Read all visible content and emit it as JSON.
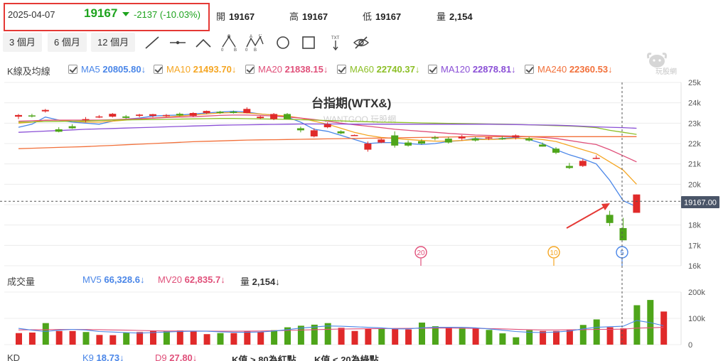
{
  "quote": {
    "date": "2025-04-07",
    "last": "19167",
    "change": "-2137 (-10.03%)",
    "stats": [
      {
        "label": "開",
        "value": "19167"
      },
      {
        "label": "高",
        "value": "19167"
      },
      {
        "label": "低",
        "value": "19167"
      },
      {
        "label": "量",
        "value": "2,154"
      }
    ]
  },
  "toolbar": {
    "periods": [
      "3 個月",
      "6 個月",
      "12 個月"
    ],
    "tools": [
      "line-tool-icon",
      "horizontal-line-icon",
      "angle-tool-icon",
      "ab-pattern-icon",
      "abc-pattern-icon",
      "circle-tool-icon",
      "rectangle-tool-icon",
      "text-tool-icon",
      "hide-eye-icon"
    ],
    "tool_text_label": "TXT",
    "pattern_letters": [
      "0",
      "A",
      "B",
      "0",
      "A",
      "B",
      "C"
    ]
  },
  "logo": {
    "text": "玩股網"
  },
  "kline_legend": {
    "title": "K線及均線",
    "mas": [
      {
        "label": "MA5",
        "value": "20805.80↓",
        "color": "#4a86e8"
      },
      {
        "label": "MA10",
        "value": "21493.70↓",
        "color": "#f5a623"
      },
      {
        "label": "MA20",
        "value": "21838.15↓",
        "color": "#e0507a"
      },
      {
        "label": "MA60",
        "value": "22740.37↓",
        "color": "#8cbf26"
      },
      {
        "label": "MA120",
        "value": "22878.81↓",
        "color": "#8a4fd6"
      },
      {
        "label": "MA240",
        "value": "22360.53↓",
        "color": "#f2703a"
      }
    ]
  },
  "volume_legend": {
    "title": "成交量",
    "items": [
      {
        "label": "MV5",
        "value": "66,328.6↓",
        "color": "#4a86e8"
      },
      {
        "label": "MV20",
        "value": "62,835.7↓",
        "color": "#e0507a"
      },
      {
        "label": "量",
        "value": "2,154↓",
        "color": "#333333"
      }
    ]
  },
  "kd_legend": {
    "title": "KD",
    "items": [
      {
        "label": "K9",
        "value": "18.73↓",
        "color": "#4a86e8"
      },
      {
        "label": "D9",
        "value": "27.80↓",
        "color": "#e0507a"
      },
      {
        "label": "K值 > 80為紅點",
        "value": "",
        "color": "#333333"
      },
      {
        "label": "K值 < 20為綠點",
        "value": "",
        "color": "#333333"
      }
    ]
  },
  "colors": {
    "up": "#e02a2a",
    "down": "#4ea51a",
    "crosshair": "#555555",
    "arrow": "#e53935"
  },
  "chart_data": {
    "type": "candlestick",
    "title": "台指期(WTX&)",
    "watermark": "WANTGOO 玩股網",
    "price_axis": {
      "ylim": [
        16000,
        25000
      ],
      "ticks": [
        16000,
        17000,
        18000,
        19000,
        20000,
        21000,
        22000,
        23000,
        24000,
        25000
      ],
      "tick_labels": [
        "16k",
        "17k",
        "18k",
        "19k",
        "20k",
        "21k",
        "22k",
        "23k",
        "24k",
        "25k"
      ]
    },
    "price_label": "19167.00",
    "crosshair_price": 19167,
    "candles": [
      {
        "o": 23320,
        "h": 23450,
        "l": 23200,
        "c": 23400
      },
      {
        "o": 23380,
        "h": 23460,
        "l": 23280,
        "c": 23340
      },
      {
        "o": 23580,
        "h": 23700,
        "l": 23520,
        "c": 23650
      },
      {
        "o": 22700,
        "h": 22800,
        "l": 22550,
        "c": 22580
      },
      {
        "o": 22850,
        "h": 22950,
        "l": 22720,
        "c": 22750
      },
      {
        "o": 23150,
        "h": 23300,
        "l": 23050,
        "c": 23200
      },
      {
        "o": 23320,
        "h": 23400,
        "l": 23250,
        "c": 23330
      },
      {
        "o": 23320,
        "h": 23500,
        "l": 23280,
        "c": 23460
      },
      {
        "o": 23330,
        "h": 23400,
        "l": 23220,
        "c": 23260
      },
      {
        "o": 23360,
        "h": 23460,
        "l": 23290,
        "c": 23420
      },
      {
        "o": 23360,
        "h": 23460,
        "l": 23280,
        "c": 23440
      },
      {
        "o": 23360,
        "h": 23450,
        "l": 23300,
        "c": 23400
      },
      {
        "o": 23460,
        "h": 23520,
        "l": 23340,
        "c": 23380
      },
      {
        "o": 23360,
        "h": 23540,
        "l": 23300,
        "c": 23500
      },
      {
        "o": 23500,
        "h": 23620,
        "l": 23450,
        "c": 23600
      },
      {
        "o": 23560,
        "h": 23600,
        "l": 23460,
        "c": 23500
      },
      {
        "o": 23560,
        "h": 23620,
        "l": 23470,
        "c": 23500
      },
      {
        "o": 23500,
        "h": 23780,
        "l": 23480,
        "c": 23700
      },
      {
        "o": 23250,
        "h": 23360,
        "l": 23200,
        "c": 23320
      },
      {
        "o": 23200,
        "h": 23500,
        "l": 23150,
        "c": 23450
      },
      {
        "o": 23450,
        "h": 23500,
        "l": 23250,
        "c": 23200
      },
      {
        "o": 22750,
        "h": 22830,
        "l": 22550,
        "c": 22650
      },
      {
        "o": 22350,
        "h": 22750,
        "l": 22300,
        "c": 22650
      },
      {
        "o": 22800,
        "h": 23050,
        "l": 22750,
        "c": 22950
      },
      {
        "o": 22600,
        "h": 22650,
        "l": 22460,
        "c": 22500
      },
      {
        "o": 22420,
        "h": 22440,
        "l": 22400,
        "c": 22420
      },
      {
        "o": 21700,
        "h": 22100,
        "l": 21600,
        "c": 22000
      },
      {
        "o": 22050,
        "h": 22240,
        "l": 22020,
        "c": 22200
      },
      {
        "o": 22400,
        "h": 22600,
        "l": 21800,
        "c": 21900
      },
      {
        "o": 22050,
        "h": 22150,
        "l": 21850,
        "c": 21900
      },
      {
        "o": 22120,
        "h": 22220,
        "l": 21950,
        "c": 22000
      },
      {
        "o": 22300,
        "h": 22380,
        "l": 22160,
        "c": 22250
      },
      {
        "o": 22240,
        "h": 22320,
        "l": 22000,
        "c": 22050
      },
      {
        "o": 22250,
        "h": 22420,
        "l": 22150,
        "c": 22350
      },
      {
        "o": 22250,
        "h": 22330,
        "l": 22100,
        "c": 22150
      },
      {
        "o": 22250,
        "h": 22340,
        "l": 22170,
        "c": 22300
      },
      {
        "o": 22260,
        "h": 22360,
        "l": 22180,
        "c": 22220
      },
      {
        "o": 22300,
        "h": 22450,
        "l": 22200,
        "c": 22400
      },
      {
        "o": 22250,
        "h": 22330,
        "l": 22100,
        "c": 22150
      },
      {
        "o": 21950,
        "h": 22050,
        "l": 21850,
        "c": 21850
      },
      {
        "o": 21750,
        "h": 21820,
        "l": 21480,
        "c": 21550
      },
      {
        "o": 20900,
        "h": 21050,
        "l": 20750,
        "c": 20800
      },
      {
        "o": 20900,
        "h": 21250,
        "l": 20850,
        "c": 21150
      },
      {
        "o": 21300,
        "h": 21420,
        "l": 21240,
        "c": 21300
      },
      {
        "o": 18500,
        "h": 18700,
        "l": 17950,
        "c": 18100
      },
      {
        "o": 17850,
        "h": 18350,
        "l": 17400,
        "c": 17250
      },
      {
        "o": 18600,
        "h": 19500,
        "l": 18600,
        "c": 19500
      }
    ],
    "ma_lines": [
      {
        "name": "MA5",
        "color": "#4a86e8",
        "values": [
          22800,
          22950,
          23300,
          23150,
          23050,
          23000,
          22950,
          23100,
          23200,
          23250,
          23350,
          23380,
          23400,
          23450,
          23500,
          23550,
          23580,
          23550,
          23450,
          23400,
          23300,
          23050,
          22700,
          22600,
          22400,
          22200,
          22000,
          22050,
          22050,
          22000,
          21950,
          22000,
          22100,
          22150,
          22250,
          22200,
          22250,
          22300,
          22200,
          22000,
          21700,
          21450,
          21250,
          21000,
          20200,
          19200,
          18900
        ]
      },
      {
        "name": "MA10",
        "color": "#f5a623",
        "values": [
          23000,
          23050,
          23150,
          23150,
          23100,
          23050,
          23050,
          23100,
          23150,
          23200,
          23250,
          23300,
          23350,
          23400,
          23450,
          23500,
          23520,
          23500,
          23450,
          23400,
          23350,
          23250,
          23100,
          22950,
          22750,
          22550,
          22400,
          22300,
          22250,
          22200,
          22150,
          22120,
          22120,
          22150,
          22200,
          22200,
          22220,
          22250,
          22250,
          22200,
          22100,
          21900,
          21700,
          21500,
          21100,
          20700,
          20000
        ]
      },
      {
        "name": "MA20",
        "color": "#e0507a",
        "values": [
          23100,
          23120,
          23140,
          23150,
          23150,
          23150,
          23150,
          23170,
          23200,
          23220,
          23250,
          23280,
          23300,
          23320,
          23350,
          23380,
          23400,
          23400,
          23380,
          23350,
          23300,
          23250,
          23180,
          23100,
          23000,
          22920,
          22850,
          22780,
          22700,
          22650,
          22600,
          22550,
          22500,
          22460,
          22420,
          22400,
          22380,
          22360,
          22340,
          22300,
          22250,
          22150,
          22050,
          21950,
          21700,
          21400,
          21100
        ]
      },
      {
        "name": "MA60",
        "color": "#8cbf26",
        "values": [
          23050,
          23060,
          23080,
          23090,
          23100,
          23110,
          23130,
          23150,
          23160,
          23170,
          23180,
          23190,
          23200,
          23210,
          23220,
          23230,
          23230,
          23220,
          23210,
          23200,
          23190,
          23170,
          23150,
          23130,
          23110,
          23090,
          23070,
          23050,
          23040,
          23030,
          23010,
          23000,
          22990,
          22980,
          22970,
          22960,
          22950,
          22940,
          22920,
          22900,
          22880,
          22860,
          22830,
          22780,
          22650,
          22550,
          22450
        ]
      },
      {
        "name": "MA120",
        "color": "#8a4fd6",
        "values": [
          22550,
          22580,
          22610,
          22640,
          22670,
          22700,
          22720,
          22740,
          22760,
          22780,
          22800,
          22820,
          22840,
          22860,
          22880,
          22900,
          22910,
          22920,
          22930,
          22940,
          22950,
          22960,
          22960,
          22960,
          22960,
          22950,
          22950,
          22950,
          22950,
          22950,
          22950,
          22950,
          22950,
          22950,
          22950,
          22950,
          22940,
          22930,
          22920,
          22910,
          22900,
          22880,
          22850,
          22820,
          22800,
          22780,
          22750
        ]
      },
      {
        "name": "MA240",
        "color": "#f2703a",
        "values": [
          21750,
          21770,
          21790,
          21810,
          21830,
          21850,
          21880,
          21910,
          21940,
          21970,
          22000,
          22030,
          22060,
          22090,
          22110,
          22130,
          22150,
          22170,
          22180,
          22190,
          22200,
          22210,
          22220,
          22230,
          22240,
          22250,
          22260,
          22270,
          22280,
          22290,
          22300,
          22310,
          22320,
          22330,
          22340,
          22340,
          22340,
          22340,
          22340,
          22340,
          22340,
          22340,
          22340,
          22340,
          22340,
          22340,
          22340
        ]
      }
    ],
    "markers": [
      {
        "index": 31,
        "text": "20",
        "color": "#e0507a"
      },
      {
        "index": 41,
        "text": "10",
        "color": "#f5a623"
      },
      {
        "index": 46,
        "text": "5",
        "color": "#4a86e8"
      }
    ],
    "volume": {
      "ylim": [
        0,
        200000
      ],
      "ticks": [
        0,
        100000,
        200000
      ],
      "tick_labels": [
        "0",
        "100k",
        "200k"
      ],
      "bars": [
        44000,
        46000,
        82000,
        52000,
        52000,
        48000,
        37000,
        36000,
        45000,
        48000,
        52000,
        51000,
        54000,
        52000,
        40000,
        44000,
        44000,
        50000,
        48000,
        55000,
        66000,
        72000,
        76000,
        82000,
        64000,
        52000,
        60000,
        62000,
        60000,
        58000,
        84000,
        70000,
        66000,
        64000,
        62000,
        56000,
        43000,
        28000,
        55000,
        52000,
        52000,
        56000,
        75000,
        96000,
        66000,
        62000,
        150000,
        170000,
        126000
      ],
      "bar_colors": [
        "up",
        "up",
        "down",
        "up",
        "up",
        "down",
        "up",
        "up",
        "down",
        "up",
        "up",
        "down",
        "up",
        "up",
        "up",
        "down",
        "up",
        "up",
        "up",
        "down",
        "down",
        "down",
        "down",
        "down",
        "up",
        "up",
        "up",
        "down",
        "up",
        "up",
        "down",
        "down",
        "up",
        "down",
        "up",
        "down",
        "down",
        "down",
        "down",
        "up",
        "up",
        "up",
        "down",
        "down",
        "up",
        "up",
        "down",
        "down",
        "up"
      ],
      "mv5": [
        62000,
        55000,
        50000,
        55000,
        58000,
        56000,
        50000,
        48000,
        46000,
        44000,
        46000,
        48000,
        50000,
        51000,
        51000,
        49000,
        47000,
        47000,
        48000,
        52000,
        57000,
        63000,
        67000,
        71000,
        70000,
        68000,
        66000,
        64000,
        60000,
        60000,
        64000,
        66000,
        66000,
        66000,
        64000,
        60000,
        55000,
        50000,
        47000,
        46000,
        48000,
        52000,
        60000,
        66000,
        68000,
        70000,
        92000,
        84000,
        72000
      ],
      "mv20": [
        56000,
        56500,
        57000,
        57500,
        58000,
        57500,
        57000,
        56000,
        55000,
        54000,
        53000,
        52000,
        52000,
        52000,
        51500,
        51000,
        51000,
        51500,
        52000,
        53000,
        54000,
        55500,
        57000,
        58500,
        59500,
        60000,
        60500,
        61000,
        61500,
        62000,
        62500,
        63000,
        63000,
        62500,
        62000,
        61000,
        60000,
        58500,
        57000,
        56000,
        56000,
        56500,
        57000,
        58000,
        58500,
        59000,
        63000,
        64000,
        66000
      ]
    }
  }
}
